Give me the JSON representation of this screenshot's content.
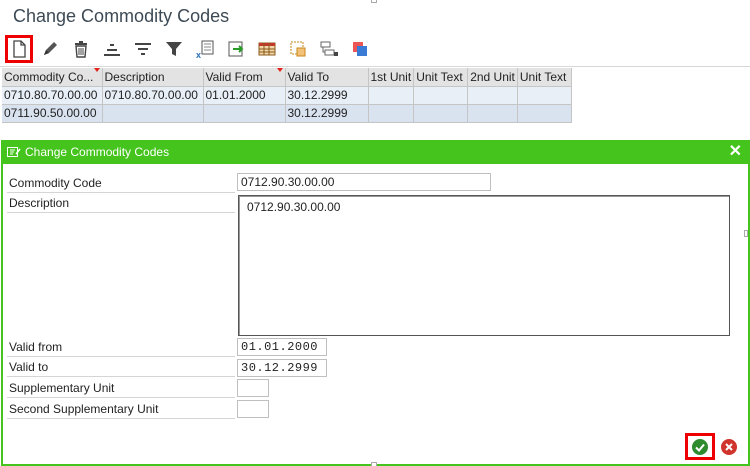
{
  "window": {
    "title": "Change Commodity Codes"
  },
  "toolbar": {
    "items": [
      {
        "icon": "new-document-icon",
        "highlighted": true
      },
      {
        "icon": "edit-pencil-icon"
      },
      {
        "icon": "delete-trash-icon"
      },
      {
        "icon": "sort-ascending-icon"
      },
      {
        "icon": "sort-descending-icon"
      },
      {
        "icon": "filter-icon"
      },
      {
        "icon": "export-excel-icon"
      },
      {
        "icon": "export-file-icon"
      },
      {
        "icon": "table-layout-icon"
      },
      {
        "icon": "change-layout-icon"
      },
      {
        "icon": "select-layout-icon"
      },
      {
        "icon": "copy-icon"
      }
    ]
  },
  "grid": {
    "columns": [
      {
        "label": "Commodity Co...",
        "sorted": true
      },
      {
        "label": "Description",
        "sorted": false
      },
      {
        "label": "Valid From",
        "sorted": true
      },
      {
        "label": "Valid To",
        "sorted": false
      },
      {
        "label": "1st Unit",
        "sorted": false
      },
      {
        "label": "Unit Text",
        "sorted": false
      },
      {
        "label": "2nd Unit",
        "sorted": false
      },
      {
        "label": "Unit Text",
        "sorted": false
      }
    ],
    "rows": [
      [
        "0710.80.70.00.00",
        "0710.80.70.00.00",
        "01.01.2000",
        "30.12.2999",
        "",
        "",
        "",
        ""
      ],
      [
        "0711.90.50.00.00",
        "",
        "",
        "30.12.2999",
        "",
        "",
        "",
        ""
      ]
    ]
  },
  "dialog": {
    "title": "Change Commodity Codes",
    "labels": {
      "commodity_code": "Commodity Code",
      "description": "Description",
      "valid_from": "Valid from",
      "valid_to": "Valid to",
      "supp_unit": "Supplementary Unit",
      "second_supp_unit": "Second Supplementary Unit"
    },
    "values": {
      "commodity_code": "0712.90.30.00.00",
      "description": "0712.90.30.00.00",
      "valid_from": "01.01.2000",
      "valid_to": "30.12.2999",
      "supp_unit": "",
      "second_supp_unit": ""
    },
    "buttons": {
      "confirm_icon": "checkmark-icon",
      "cancel_icon": "cancel-icon"
    }
  },
  "colors": {
    "dialog_header": "#44c41c",
    "highlight": "#e00000",
    "row_bg": "#dfe8f2"
  }
}
